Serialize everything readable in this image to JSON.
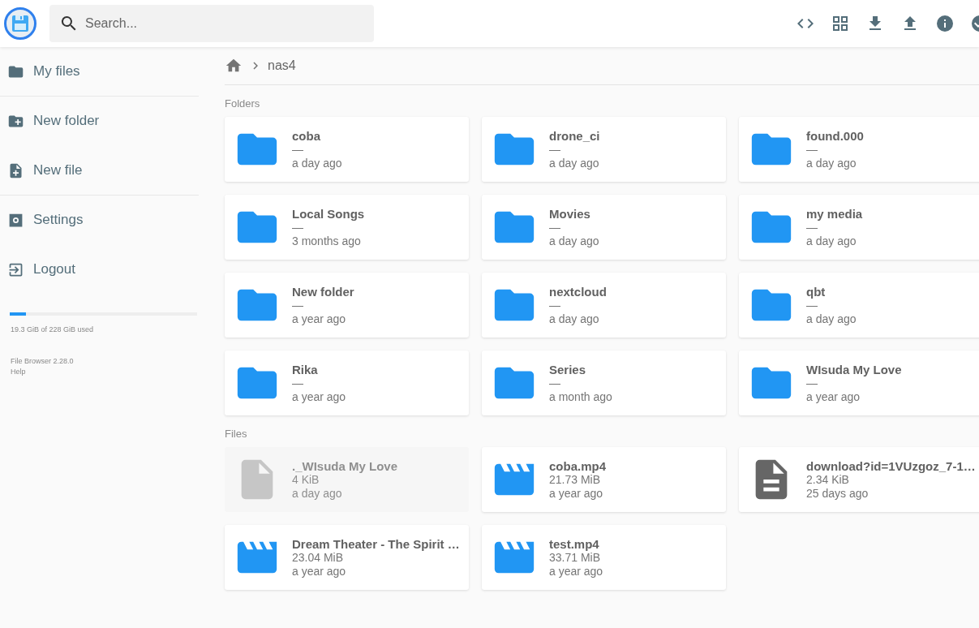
{
  "header": {
    "search": {
      "placeholder": "Search..."
    },
    "actions": [
      {
        "kind": "code"
      },
      {
        "kind": "grid"
      },
      {
        "kind": "download"
      },
      {
        "kind": "upload"
      },
      {
        "kind": "info"
      },
      {
        "kind": "check"
      }
    ]
  },
  "sidebar": {
    "items": [
      {
        "kind": "folder",
        "label": "My files",
        "divider": true
      },
      {
        "kind": "folder-plus",
        "label": "New folder",
        "divider": false
      },
      {
        "kind": "file-plus",
        "label": "New file",
        "divider": true
      },
      {
        "kind": "settings",
        "label": "Settings",
        "divider": false
      },
      {
        "kind": "logout",
        "label": "Logout",
        "divider": false
      }
    ],
    "storage": {
      "level": 0.085,
      "text": "19.3 GiB of 228 GiB used"
    },
    "version": "File Browser 2.28.0",
    "help": "Help"
  },
  "breadcrumb": [
    "nas4"
  ],
  "sections": [
    {
      "title": "Folders",
      "items": [
        {
          "kind": "folder",
          "name": "coba",
          "size": "—",
          "modified": "a day ago",
          "dimmed": false
        },
        {
          "kind": "folder",
          "name": "drone_ci",
          "size": "—",
          "modified": "a day ago",
          "dimmed": false
        },
        {
          "kind": "folder",
          "name": "found.000",
          "size": "—",
          "modified": "a day ago",
          "dimmed": false
        },
        {
          "kind": "folder",
          "name": "Local Songs",
          "size": "—",
          "modified": "3 months ago",
          "dimmed": false
        },
        {
          "kind": "folder",
          "name": "Movies",
          "size": "—",
          "modified": "a day ago",
          "dimmed": false
        },
        {
          "kind": "folder",
          "name": "my media",
          "size": "—",
          "modified": "a day ago",
          "dimmed": false
        },
        {
          "kind": "folder",
          "name": "New folder",
          "size": "—",
          "modified": "a year ago",
          "dimmed": false
        },
        {
          "kind": "folder",
          "name": "nextcloud",
          "size": "—",
          "modified": "a day ago",
          "dimmed": false
        },
        {
          "kind": "folder",
          "name": "qbt",
          "size": "—",
          "modified": "a day ago",
          "dimmed": false
        },
        {
          "kind": "folder",
          "name": "Rika",
          "size": "—",
          "modified": "a year ago",
          "dimmed": false
        },
        {
          "kind": "folder",
          "name": "Series",
          "size": "—",
          "modified": "a month ago",
          "dimmed": false
        },
        {
          "kind": "folder",
          "name": "WIsuda My Love",
          "size": "—",
          "modified": "a year ago",
          "dimmed": false
        }
      ]
    },
    {
      "title": "Files",
      "items": [
        {
          "kind": "blank",
          "name": "._WIsuda My Love",
          "size": "4 KiB",
          "modified": "a day ago",
          "dimmed": true
        },
        {
          "kind": "video",
          "name": "coba.mp4",
          "size": "21.73 MiB",
          "modified": "a year ago",
          "dimmed": false
        },
        {
          "kind": "text",
          "name": "download?id=1VUzgoz_7-1…",
          "size": "2.34 KiB",
          "modified": "25 days ago",
          "dimmed": false
        },
        {
          "kind": "video",
          "name": "Dream Theater - The Spirit …",
          "size": "23.04 MiB",
          "modified": "a year ago",
          "dimmed": false
        },
        {
          "kind": "video",
          "name": "test.mp4",
          "size": "33.71 MiB",
          "modified": "a year ago",
          "dimmed": false
        }
      ]
    }
  ]
}
